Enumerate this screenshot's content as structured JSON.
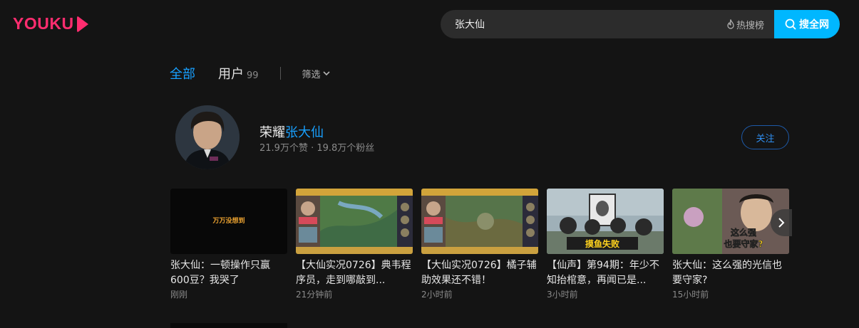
{
  "header": {
    "logo_text": "YOUKU",
    "search": {
      "value": "张大仙",
      "hot_label": "热搜榜",
      "button_label": "搜全网"
    }
  },
  "tabs": {
    "all": "全部",
    "user": "用户",
    "user_count": "99",
    "filter": "筛选"
  },
  "user": {
    "name_prefix": "荣耀",
    "name_highlight": "张大仙",
    "stats": "21.9万个赞 · 19.8万个粉丝",
    "follow_label": "关注"
  },
  "videos": [
    {
      "title": "张大仙：一顿操作只赢600豆？我哭了",
      "time": "刚刚"
    },
    {
      "title": "【大仙实况0726】典韦程序员，走到哪敲到...",
      "time": "21分钟前"
    },
    {
      "title": "【大仙实况0726】橘子辅助效果还不错！",
      "time": "2小时前"
    },
    {
      "title": "【仙声】第94期：年少不知抬棺意，再闻已是...",
      "time": "3小时前"
    },
    {
      "title": "张大仙：这么强的光信也要守家?",
      "time": "15小时前"
    }
  ],
  "thumb_text": {
    "v1": "万万没想到",
    "v4": "摸鱼失败",
    "v5_line1": "这么强",
    "v5_line2": "也要守家?"
  },
  "colors": {
    "brand": "#ff2d6f",
    "accent": "#18a0ff",
    "search_button": "#00b7ff",
    "background": "#141414"
  }
}
